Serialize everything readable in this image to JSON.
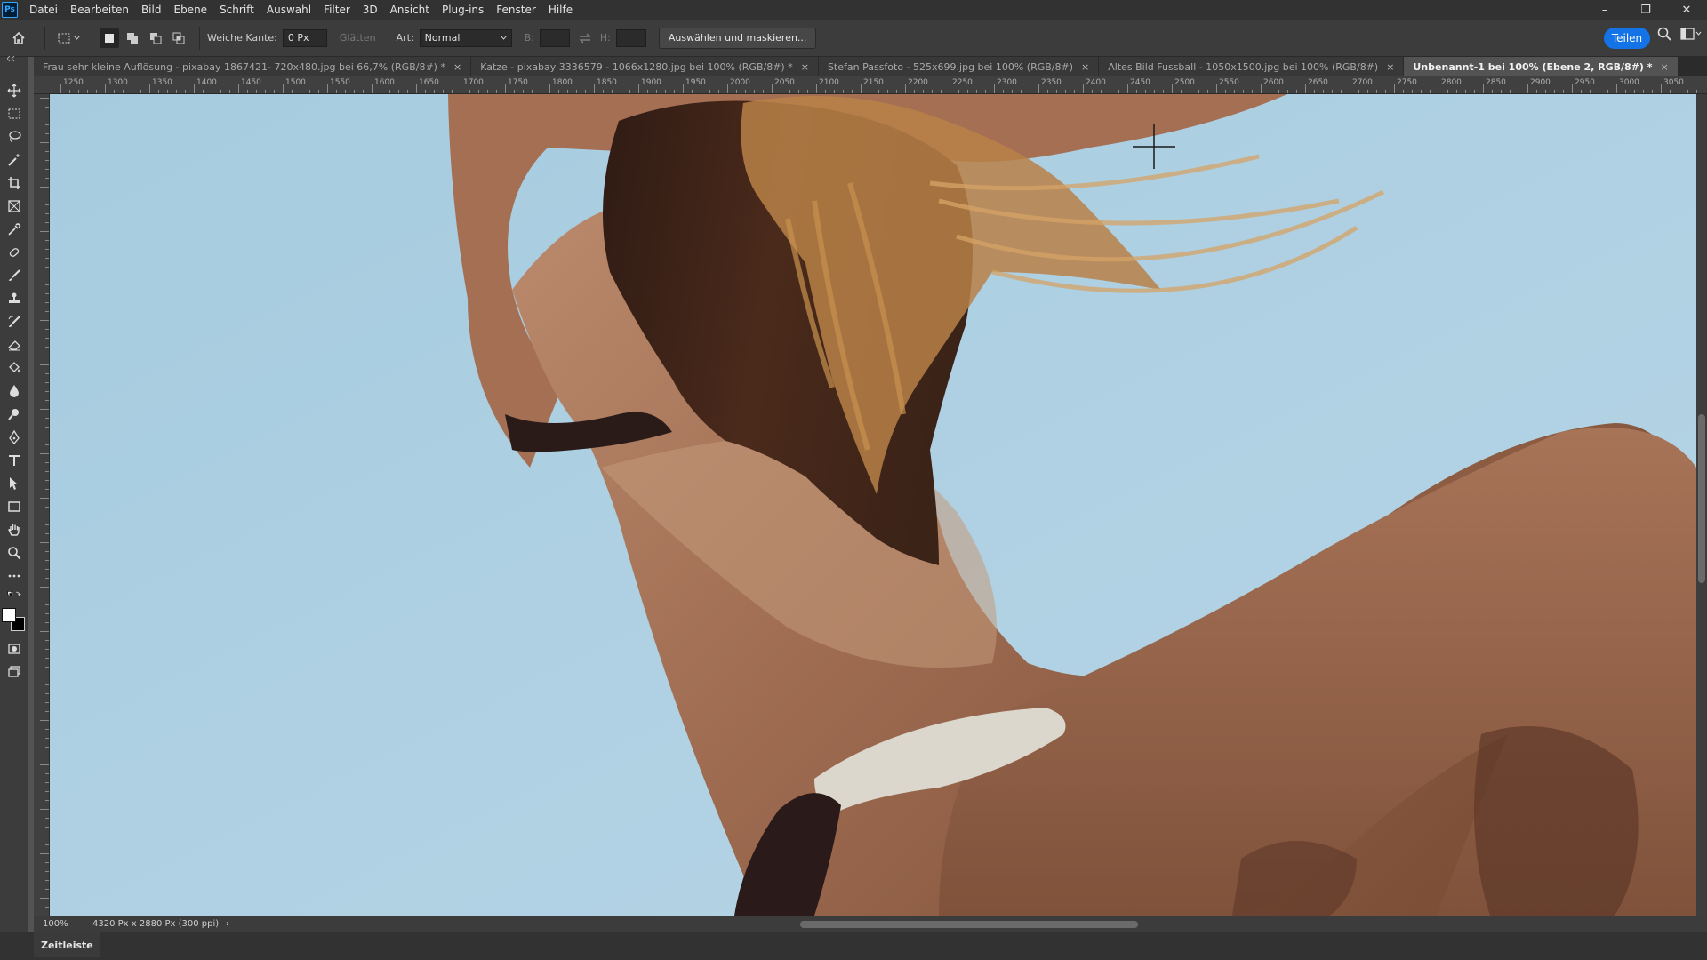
{
  "app": {
    "logo": "Ps"
  },
  "menu": [
    "Datei",
    "Bearbeiten",
    "Bild",
    "Ebene",
    "Schrift",
    "Auswahl",
    "Filter",
    "3D",
    "Ansicht",
    "Plug-ins",
    "Fenster",
    "Hilfe"
  ],
  "window_controls": {
    "minimize": "–",
    "restore": "❐",
    "close": "✕"
  },
  "options": {
    "feather_label": "Weiche Kante:",
    "feather_value": "0 Px",
    "antialias_label": "Glätten",
    "style_label": "Art:",
    "style_value": "Normal",
    "width_label": "B:",
    "height_label": "H:",
    "select_mask_label": "Auswählen und maskieren...",
    "share_label": "Teilen"
  },
  "tabs": [
    {
      "label": "Frau sehr kleine Auflösung - pixabay 1867421- 720x480.jpg bei 66,7% (RGB/8#) *",
      "close": "×"
    },
    {
      "label": "Katze - pixabay 3336579 - 1066x1280.jpg bei 100% (RGB/8#) *",
      "close": "×"
    },
    {
      "label": "Stefan Passfoto - 525x699.jpg bei 100% (RGB/8#)",
      "close": "×"
    },
    {
      "label": "Altes Bild Fussball - 1050x1500.jpg bei 100% (RGB/8#)",
      "close": "×"
    },
    {
      "label": "Unbenannt-1 bei 100% (Ebene 2, RGB/8#) *",
      "close": "×"
    }
  ],
  "ruler": {
    "labels": [
      "1250",
      "1300",
      "1350",
      "1400",
      "1450",
      "1500",
      "1550",
      "1600",
      "1650",
      "1700",
      "1750",
      "1800",
      "1850",
      "1900",
      "1950",
      "2000",
      "2050",
      "2100",
      "2150",
      "2200",
      "2250",
      "2300",
      "2350",
      "2400",
      "2450",
      "2500",
      "2550",
      "2600",
      "2650",
      "2700",
      "2750",
      "2800",
      "2850",
      "2900",
      "2950",
      "3000",
      "3050"
    ]
  },
  "status": {
    "zoom": "100%",
    "doc_info": "4320 Px x 2880 Px (300 ppi)",
    "arrow": "›"
  },
  "timeline": {
    "tab_label": "Zeitleiste"
  },
  "colors": {
    "sky": "#a9cde0",
    "skin": "#a77256",
    "hair_dark": "#3a2219",
    "hair_light": "#c89150",
    "bikini_white": "#dcd7cc",
    "accent_blue": "#1473e6"
  },
  "icons": [
    "home-icon",
    "marquee-icon",
    "move-icon",
    "rect-marquee-icon",
    "lasso-icon",
    "magic-wand-icon",
    "crop-icon",
    "frame-icon",
    "eyedropper-icon",
    "healing-brush-icon",
    "brush-icon",
    "clone-stamp-icon",
    "history-brush-icon",
    "eraser-icon",
    "paint-bucket-icon",
    "blur-icon",
    "dodge-icon",
    "pen-icon",
    "type-icon",
    "path-select-icon",
    "rectangle-icon",
    "hand-icon",
    "zoom-icon",
    "more-icon",
    "swap-colors-icon",
    "quick-mask-icon",
    "screen-mode-icon",
    "search-icon",
    "workspace-icon"
  ]
}
